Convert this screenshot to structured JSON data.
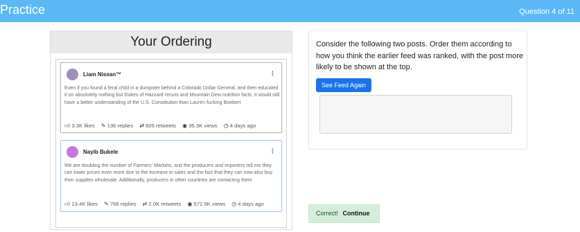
{
  "header": {
    "brand": "Practice",
    "question_counter": "Question 4 of 11",
    "bar_color": "#5bb8f5"
  },
  "ordering": {
    "title": "Your Ordering",
    "posts": [
      {
        "username": "Liam Nissan™",
        "avatar_color": "#a08fb5",
        "menu": "⋮",
        "text": "Even if you found a feral child in a dumpster behind a Colorado Dollar General, and then educated it on absolutely nothing but Dukes of Hazzard reruns and Mountain Dew nutrition facts, it would still have a better understanding of the U.S. Constitution than Lauren fucking Boebert",
        "likes": "3.3K likes",
        "replies": "136 replies",
        "retweets": "605 retweets",
        "views": "35.3K views",
        "time": "4 days ago"
      },
      {
        "username": "Nayib Bukele",
        "avatar_color": "#c378e0",
        "menu": "⋮",
        "text": "We are doubling the number of Farmers' Markets, and the producers and importers tell me they can lower prices even more due to the increase in sales and the fact that they can now also buy their supplies wholesale. Additionally, producers in other countries are contacting them",
        "likes": "13.4K likes",
        "replies": "768 replies",
        "retweets": "2.0K retweets",
        "views": "572.5K views",
        "time": "4 days ago"
      }
    ]
  },
  "question": {
    "prompt": "Consider the following two posts. Order them according to how you think the earlier feed was ranked, with the post more likely to be shown at the top.",
    "see_feed_button": "See Feed Again",
    "button_color": "#1a73e8",
    "answer_value": ""
  },
  "feedback": {
    "status": "Correct!",
    "continue_label": "Continue",
    "color": "#d4edda"
  },
  "icons": {
    "like": "thumbs-up-icon",
    "reply": "reply-icon",
    "retweet": "retweet-icon",
    "views": "eye-icon",
    "time": "clock-icon",
    "menu": "more-vertical-icon"
  }
}
